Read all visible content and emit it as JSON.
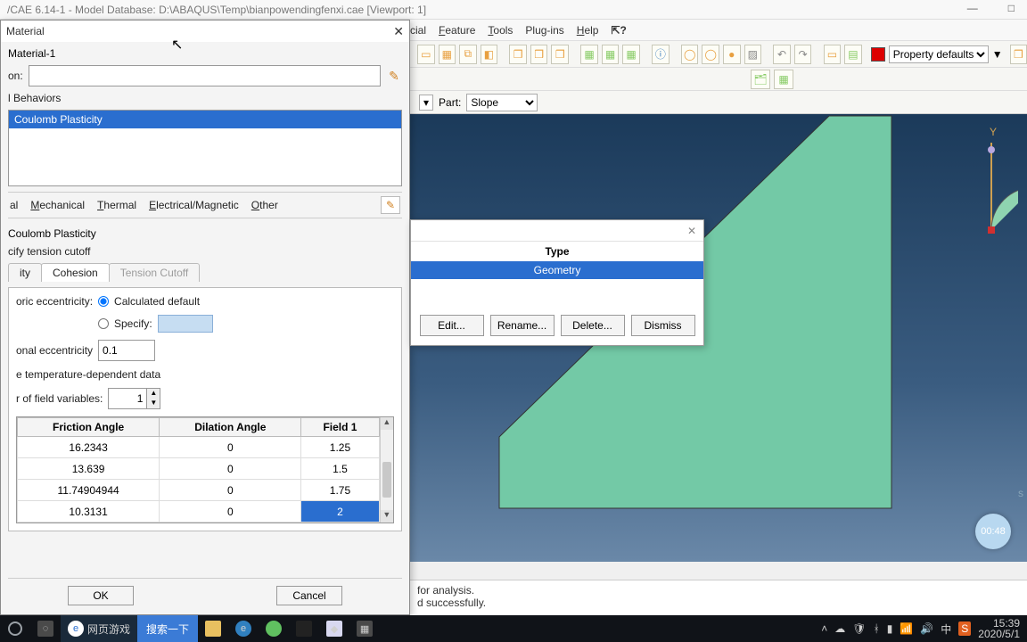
{
  "window": {
    "title": "/CAE 6.14-1 - Model Database: D:\\ABAQUS\\Temp\\bianpowendingfenxi.cae [Viewport: 1]"
  },
  "menu": {
    "partial": "cial",
    "feature": "Feature",
    "tools": "Tools",
    "plugins": "Plug-ins",
    "help": "Help"
  },
  "toolbar": {
    "property_defaults": "Property defaults"
  },
  "partrow": {
    "label": "Part:",
    "value": "Slope"
  },
  "material_dialog": {
    "title": "Material",
    "name_value": "Material-1",
    "desc_label": "on:",
    "behaviors_label": "l Behaviors",
    "behavior_item": "Coulomb Plasticity",
    "tabs": {
      "general": "al",
      "mechanical": "Mechanical",
      "thermal": "Thermal",
      "elecmag": "Electrical/Magnetic",
      "other": "Other"
    },
    "section_title": "Coulomb Plasticity",
    "tension_cutoff_chk": "cify tension cutoff",
    "subtabs": {
      "plasticity": "ity",
      "cohesion": "Cohesion",
      "tension": "Tension Cutoff"
    },
    "ecc_label": "oric eccentricity:",
    "ecc_calc": "Calculated default",
    "ecc_specify": "Specify:",
    "merid_label": "onal eccentricity",
    "merid_value": "0.1",
    "tempdep": "e temperature-dependent data",
    "fieldvars_label": "r of field variables:",
    "fieldvars_value": "1",
    "table": {
      "h1": "Friction Angle",
      "h2": "Dilation Angle",
      "h3": "Field 1",
      "rows": [
        {
          "a": "16.2343",
          "b": "0",
          "c": "1.25"
        },
        {
          "a": "13.639",
          "b": "0",
          "c": "1.5"
        },
        {
          "a": "11.74904944",
          "b": "0",
          "c": "1.75"
        },
        {
          "a": "10.3131",
          "b": "0",
          "c": "2"
        }
      ]
    },
    "ok": "OK",
    "cancel": "Cancel"
  },
  "geom_dialog": {
    "type_label": "Type",
    "type_value": "Geometry",
    "edit": "Edit...",
    "rename": "Rename...",
    "delete": "Delete...",
    "dismiss": "Dismiss"
  },
  "viewport": {
    "y_label": "Y",
    "timer": "00:48",
    "watermark": "s"
  },
  "messages": {
    "l1": " for analysis.",
    "l2": "d successfully."
  },
  "taskbar": {
    "ie_label": "网页游戏",
    "search": "搜索一下",
    "time": "15:39",
    "date": "2020/5/1",
    "ime": "中"
  }
}
